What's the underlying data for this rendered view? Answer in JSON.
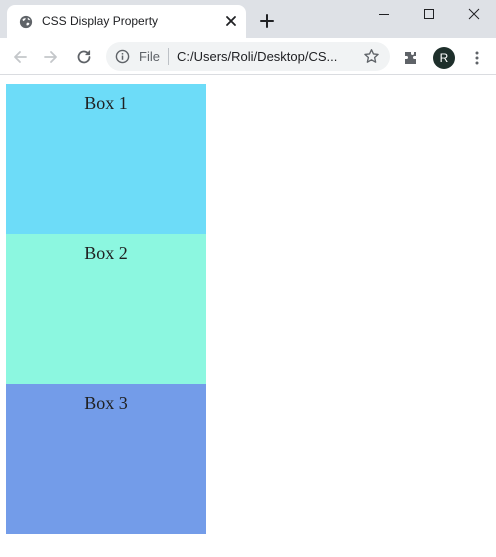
{
  "browser": {
    "tab_title": "CSS Display Property",
    "omnibox": {
      "scheme_label": "File",
      "url": "C:/Users/Roli/Desktop/CS..."
    },
    "profile_initial": "R"
  },
  "page": {
    "boxes": [
      {
        "label": "Box 1",
        "color": "#6ddcf8"
      },
      {
        "label": "Box 2",
        "color": "#8cf7e0"
      },
      {
        "label": "Box 3",
        "color": "#739ce9"
      }
    ]
  }
}
